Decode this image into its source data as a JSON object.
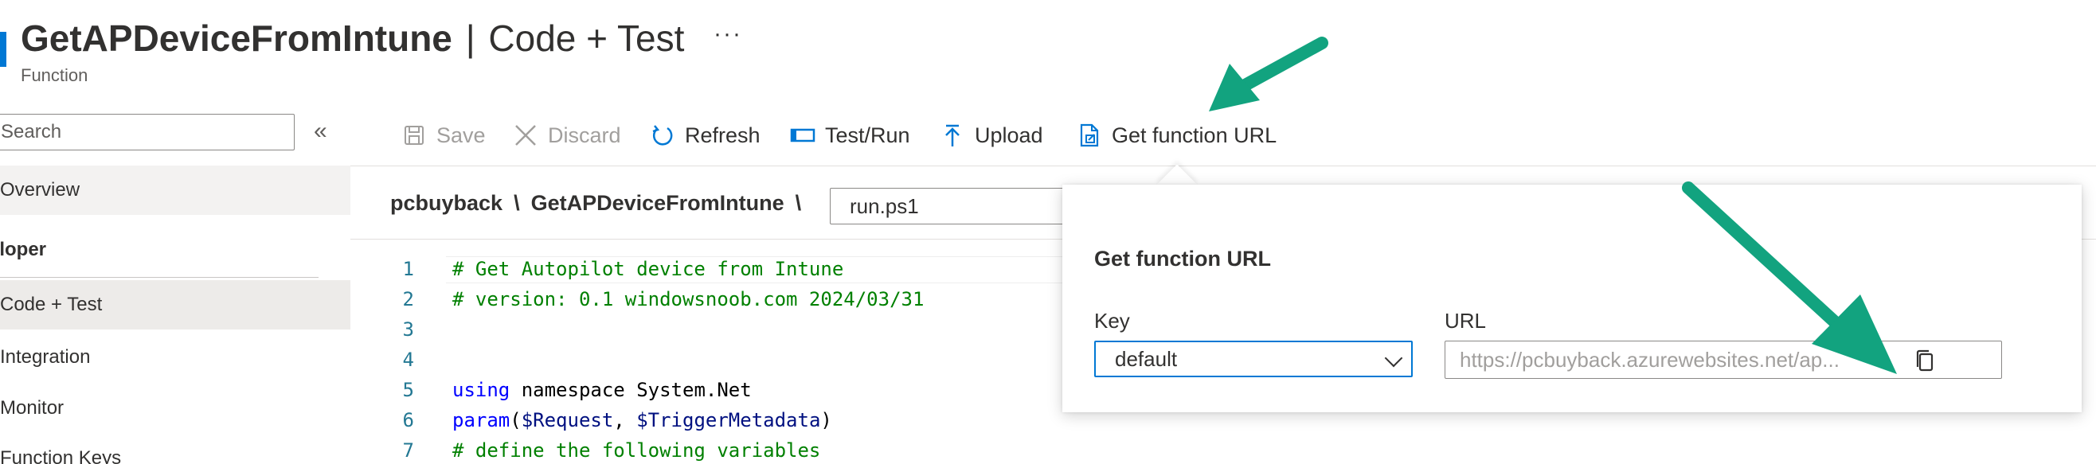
{
  "header": {
    "title_name": "GetAPDeviceFromIntune",
    "title_separator": "|",
    "title_page": "Code + Test",
    "more": "···",
    "subtitle": "Function"
  },
  "sidebar": {
    "search_placeholder": "Search",
    "collapse": "«",
    "items": [
      {
        "label": "Overview"
      },
      {
        "label": "Code + Test"
      },
      {
        "label": "Integration"
      },
      {
        "label": "Monitor"
      },
      {
        "label": "Function Keys"
      }
    ],
    "section": "eloper"
  },
  "toolbar": {
    "save": "Save",
    "discard": "Discard",
    "refresh": "Refresh",
    "test_run": "Test/Run",
    "upload": "Upload",
    "get_url": "Get function URL"
  },
  "breadcrumb": {
    "app": "pcbuyback",
    "sep": "\\",
    "function": "GetAPDeviceFromIntune",
    "file": "run.ps1"
  },
  "editor": {
    "lines": [
      {
        "no": "1",
        "comment": "# Get Autopilot device from Intune"
      },
      {
        "no": "2",
        "comment": "# version: 0.1 windowsnoob.com 2024/03/31"
      },
      {
        "no": "3"
      },
      {
        "no": "4"
      },
      {
        "no": "5",
        "kw": "using",
        "rest": " namespace System.Net"
      },
      {
        "no": "6",
        "kw": "param",
        "open": "(",
        "var1": "$Request",
        "comma": ", ",
        "var2": "$TriggerMetadata",
        "close": ")"
      },
      {
        "no": "7",
        "comment": "# define the following variables"
      }
    ]
  },
  "popup": {
    "title": "Get function URL",
    "key_label": "Key",
    "key_value": "default",
    "url_label": "URL",
    "url_value": "https://pcbuyback.azurewebsites.net/ap..."
  },
  "colors": {
    "accent": "#0078d4",
    "annotation_arrow": "#12a37f",
    "comment": "#008000",
    "keyword": "#0000ff"
  }
}
